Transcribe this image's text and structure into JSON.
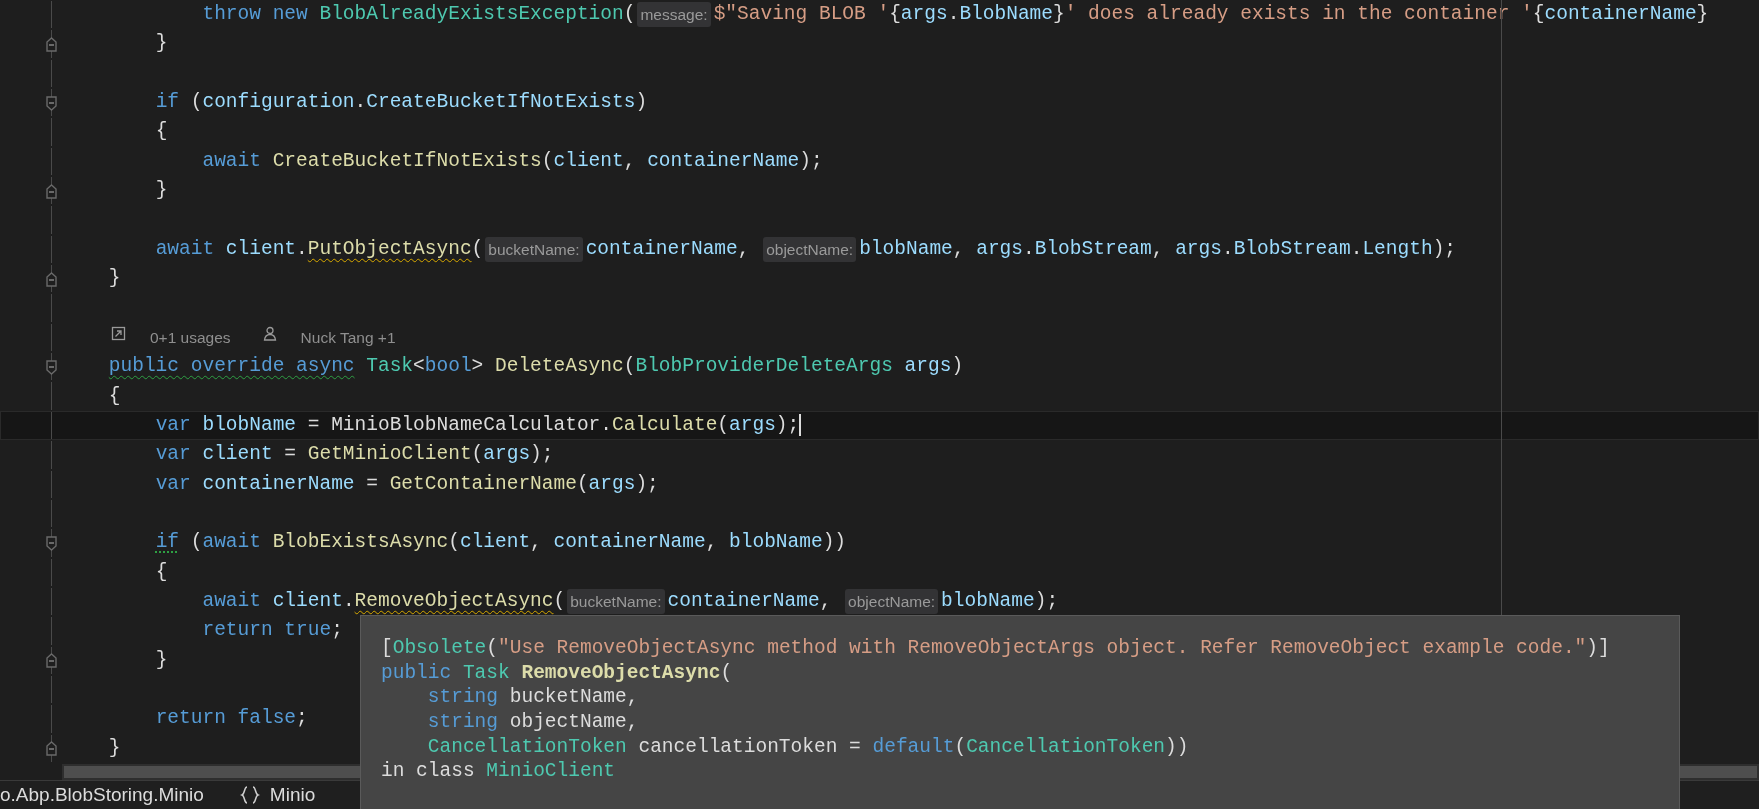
{
  "editor": {
    "lines": [
      {
        "kind": "code",
        "current": false,
        "tokens": [
          {
            "kind": "kw",
            "t": "            throw new"
          },
          {
            "kind": "type",
            "t": " BlobAlreadyExistsException"
          },
          {
            "kind": "p",
            "t": "("
          },
          {
            "kind": "hint",
            "t": "message:"
          },
          {
            "kind": "str",
            "t": "$\"Saving BLOB '"
          },
          {
            "kind": "p",
            "t": "{"
          },
          {
            "kind": "id",
            "t": "args"
          },
          {
            "kind": "p",
            "t": "."
          },
          {
            "kind": "id",
            "t": "BlobName"
          },
          {
            "kind": "p",
            "t": "}"
          },
          {
            "kind": "str",
            "t": "' does already exists in the container '"
          },
          {
            "kind": "p",
            "t": "{"
          },
          {
            "kind": "id",
            "t": "containerName"
          },
          {
            "kind": "p",
            "t": "}"
          }
        ]
      },
      {
        "kind": "code",
        "current": false,
        "fold": {
          "kind": "end"
        },
        "tokens": [
          {
            "kind": "p",
            "t": "        }"
          }
        ]
      },
      {
        "kind": "blank"
      },
      {
        "kind": "code",
        "current": false,
        "fold": {
          "kind": "start"
        },
        "tokens": [
          {
            "kind": "kw",
            "t": "        if"
          },
          {
            "kind": "p",
            "t": " ("
          },
          {
            "kind": "id",
            "t": "configuration"
          },
          {
            "kind": "p",
            "t": "."
          },
          {
            "kind": "id",
            "t": "CreateBucketIfNotExists"
          },
          {
            "kind": "p",
            "t": ")"
          }
        ]
      },
      {
        "kind": "code",
        "current": false,
        "tokens": [
          {
            "kind": "p",
            "t": "        {"
          }
        ]
      },
      {
        "kind": "code",
        "current": false,
        "tokens": [
          {
            "kind": "kw",
            "t": "            await"
          },
          {
            "kind": "fn",
            "t": " CreateBucketIfNotExists"
          },
          {
            "kind": "p",
            "t": "("
          },
          {
            "kind": "id",
            "t": "client"
          },
          {
            "kind": "p",
            "t": ", "
          },
          {
            "kind": "id",
            "t": "containerName"
          },
          {
            "kind": "p",
            "t": ");"
          }
        ]
      },
      {
        "kind": "code",
        "current": false,
        "fold": {
          "kind": "end"
        },
        "tokens": [
          {
            "kind": "p",
            "t": "        }"
          }
        ]
      },
      {
        "kind": "blank"
      },
      {
        "kind": "code",
        "current": false,
        "tokens": [
          {
            "kind": "kw",
            "t": "        await"
          },
          {
            "kind": "id",
            "t": " client"
          },
          {
            "kind": "p",
            "t": "."
          },
          {
            "kind": "fn",
            "t": "PutObjectAsync",
            "squiggle": {
              "kind": "warning"
            }
          },
          {
            "kind": "p",
            "t": "("
          },
          {
            "kind": "hint",
            "t": "bucketName:"
          },
          {
            "kind": "id",
            "t": "containerName"
          },
          {
            "kind": "p",
            "t": ", "
          },
          {
            "kind": "hint",
            "t": "objectName:"
          },
          {
            "kind": "id",
            "t": "blobName"
          },
          {
            "kind": "p",
            "t": ", "
          },
          {
            "kind": "id",
            "t": "args"
          },
          {
            "kind": "p",
            "t": "."
          },
          {
            "kind": "id",
            "t": "BlobStream"
          },
          {
            "kind": "p",
            "t": ", "
          },
          {
            "kind": "id",
            "t": "args"
          },
          {
            "kind": "p",
            "t": "."
          },
          {
            "kind": "id",
            "t": "BlobStream"
          },
          {
            "kind": "p",
            "t": "."
          },
          {
            "kind": "id",
            "t": "Length"
          },
          {
            "kind": "p",
            "t": ");"
          }
        ]
      },
      {
        "kind": "code",
        "current": false,
        "fold": {
          "kind": "end"
        },
        "tokens": [
          {
            "kind": "p",
            "t": "    }"
          }
        ]
      },
      {
        "kind": "blank"
      },
      {
        "kind": "codelens",
        "items": [
          {
            "text": "0+1 usages"
          },
          {
            "text": "Nuck Tang +1"
          }
        ]
      },
      {
        "kind": "code",
        "current": false,
        "fold": {
          "kind": "start"
        },
        "tokens": [
          {
            "kind": "kw",
            "t": "    public override async",
            "squiggle": {
              "kind": "suggestion"
            }
          },
          {
            "kind": "type",
            "t": " Task"
          },
          {
            "kind": "p",
            "t": "<"
          },
          {
            "kind": "kw",
            "t": "bool"
          },
          {
            "kind": "p",
            "t": ">"
          },
          {
            "kind": "fn",
            "t": " DeleteAsync"
          },
          {
            "kind": "p",
            "t": "("
          },
          {
            "kind": "type",
            "t": "BlobProviderDeleteArgs"
          },
          {
            "kind": "id",
            "t": " args"
          },
          {
            "kind": "p",
            "t": ")"
          }
        ]
      },
      {
        "kind": "code",
        "current": false,
        "tokens": [
          {
            "kind": "p",
            "t": "    {"
          }
        ]
      },
      {
        "kind": "code",
        "current": true,
        "tokens": [
          {
            "kind": "kw",
            "t": "        var"
          },
          {
            "kind": "id",
            "t": " blobName"
          },
          {
            "kind": "p",
            "t": " = MinioBlobNameCalculator."
          },
          {
            "kind": "fn",
            "t": "Calculate"
          },
          {
            "kind": "p",
            "t": "("
          },
          {
            "kind": "id",
            "t": "args"
          },
          {
            "kind": "p",
            "t": ");"
          }
        ]
      },
      {
        "kind": "code",
        "current": false,
        "tokens": [
          {
            "kind": "kw",
            "t": "        var"
          },
          {
            "kind": "id",
            "t": " client"
          },
          {
            "kind": "p",
            "t": " ="
          },
          {
            "kind": "fn",
            "t": " GetMinioClient"
          },
          {
            "kind": "p",
            "t": "("
          },
          {
            "kind": "id",
            "t": "args"
          },
          {
            "kind": "p",
            "t": ");"
          }
        ]
      },
      {
        "kind": "code",
        "current": false,
        "tokens": [
          {
            "kind": "kw",
            "t": "        var"
          },
          {
            "kind": "id",
            "t": " containerName"
          },
          {
            "kind": "p",
            "t": " ="
          },
          {
            "kind": "fn",
            "t": " GetContainerName"
          },
          {
            "kind": "p",
            "t": "("
          },
          {
            "kind": "id",
            "t": "args"
          },
          {
            "kind": "p",
            "t": ");"
          }
        ]
      },
      {
        "kind": "blank"
      },
      {
        "kind": "code",
        "current": false,
        "fold": {
          "kind": "start"
        },
        "tokens": [
          {
            "kind": "kw",
            "t": "        if",
            "squiggle": {
              "kind": "dotted"
            }
          },
          {
            "kind": "p",
            "t": " ("
          },
          {
            "kind": "kw",
            "t": "await"
          },
          {
            "kind": "fn",
            "t": " BlobExistsAsync"
          },
          {
            "kind": "p",
            "t": "("
          },
          {
            "kind": "id",
            "t": "client"
          },
          {
            "kind": "p",
            "t": ", "
          },
          {
            "kind": "id",
            "t": "containerName"
          },
          {
            "kind": "p",
            "t": ", "
          },
          {
            "kind": "id",
            "t": "blobName"
          },
          {
            "kind": "p",
            "t": "))"
          }
        ]
      },
      {
        "kind": "code",
        "current": false,
        "tokens": [
          {
            "kind": "p",
            "t": "        {"
          }
        ]
      },
      {
        "kind": "code",
        "current": false,
        "tokens": [
          {
            "kind": "kw",
            "t": "            await"
          },
          {
            "kind": "id",
            "t": " client"
          },
          {
            "kind": "p",
            "t": "."
          },
          {
            "kind": "fn",
            "t": "RemoveObjectAsync",
            "squiggle": {
              "kind": "warning"
            }
          },
          {
            "kind": "p",
            "t": "("
          },
          {
            "kind": "hint",
            "t": "bucketName:"
          },
          {
            "kind": "id",
            "t": "containerName"
          },
          {
            "kind": "p",
            "t": ", "
          },
          {
            "kind": "hint",
            "t": "objectName:"
          },
          {
            "kind": "id",
            "t": "blobName"
          },
          {
            "kind": "p",
            "t": ");"
          }
        ]
      },
      {
        "kind": "code",
        "current": false,
        "tokens": [
          {
            "kind": "kw",
            "t": "            return true"
          },
          {
            "kind": "p",
            "t": ";"
          }
        ]
      },
      {
        "kind": "code",
        "current": false,
        "fold": {
          "kind": "end"
        },
        "tokens": [
          {
            "kind": "p",
            "t": "        }"
          }
        ]
      },
      {
        "kind": "blank"
      },
      {
        "kind": "code",
        "current": false,
        "tokens": [
          {
            "kind": "kw",
            "t": "        return false"
          },
          {
            "kind": "p",
            "t": ";"
          }
        ]
      },
      {
        "kind": "code",
        "current": false,
        "fold": {
          "kind": "end"
        },
        "tokens": [
          {
            "kind": "p",
            "t": "    }"
          }
        ]
      }
    ]
  },
  "tooltip": {
    "lines": [
      {
        "tokens": [
          {
            "kind": "p",
            "t": "["
          },
          {
            "kind": "type",
            "t": "Obsolete"
          },
          {
            "kind": "p",
            "t": "("
          },
          {
            "kind": "str",
            "t": "\"Use RemoveObjectAsync method with RemoveObjectArgs object. Refer RemoveObject example code.\""
          },
          {
            "kind": "p",
            "t": ")]"
          }
        ]
      },
      {
        "tokens": [
          {
            "kind": "kw",
            "t": "public"
          },
          {
            "kind": "type",
            "t": " Task"
          },
          {
            "kind": "fnb",
            "t": " RemoveObjectAsync"
          },
          {
            "kind": "p",
            "t": "("
          }
        ]
      },
      {
        "tokens": [
          {
            "kind": "kw",
            "t": "    string"
          },
          {
            "kind": "p",
            "t": " bucketName,"
          }
        ]
      },
      {
        "tokens": [
          {
            "kind": "kw",
            "t": "    string"
          },
          {
            "kind": "p",
            "t": " objectName,"
          }
        ]
      },
      {
        "tokens": [
          {
            "kind": "type",
            "t": "    CancellationToken"
          },
          {
            "kind": "p",
            "t": " cancellationToken ="
          },
          {
            "kind": "kw",
            "t": " default"
          },
          {
            "kind": "p",
            "t": "("
          },
          {
            "kind": "type",
            "t": "CancellationToken"
          },
          {
            "kind": "p",
            "t": "))"
          }
        ]
      },
      {
        "tokens": [
          {
            "kind": "p",
            "t": "in class"
          },
          {
            "kind": "type",
            "t": " MinioClient"
          }
        ]
      }
    ]
  },
  "status_bar": {
    "items": [
      {
        "text": "o.Abp.BlobStoring.Minio"
      },
      {
        "text": "Minio"
      }
    ]
  }
}
